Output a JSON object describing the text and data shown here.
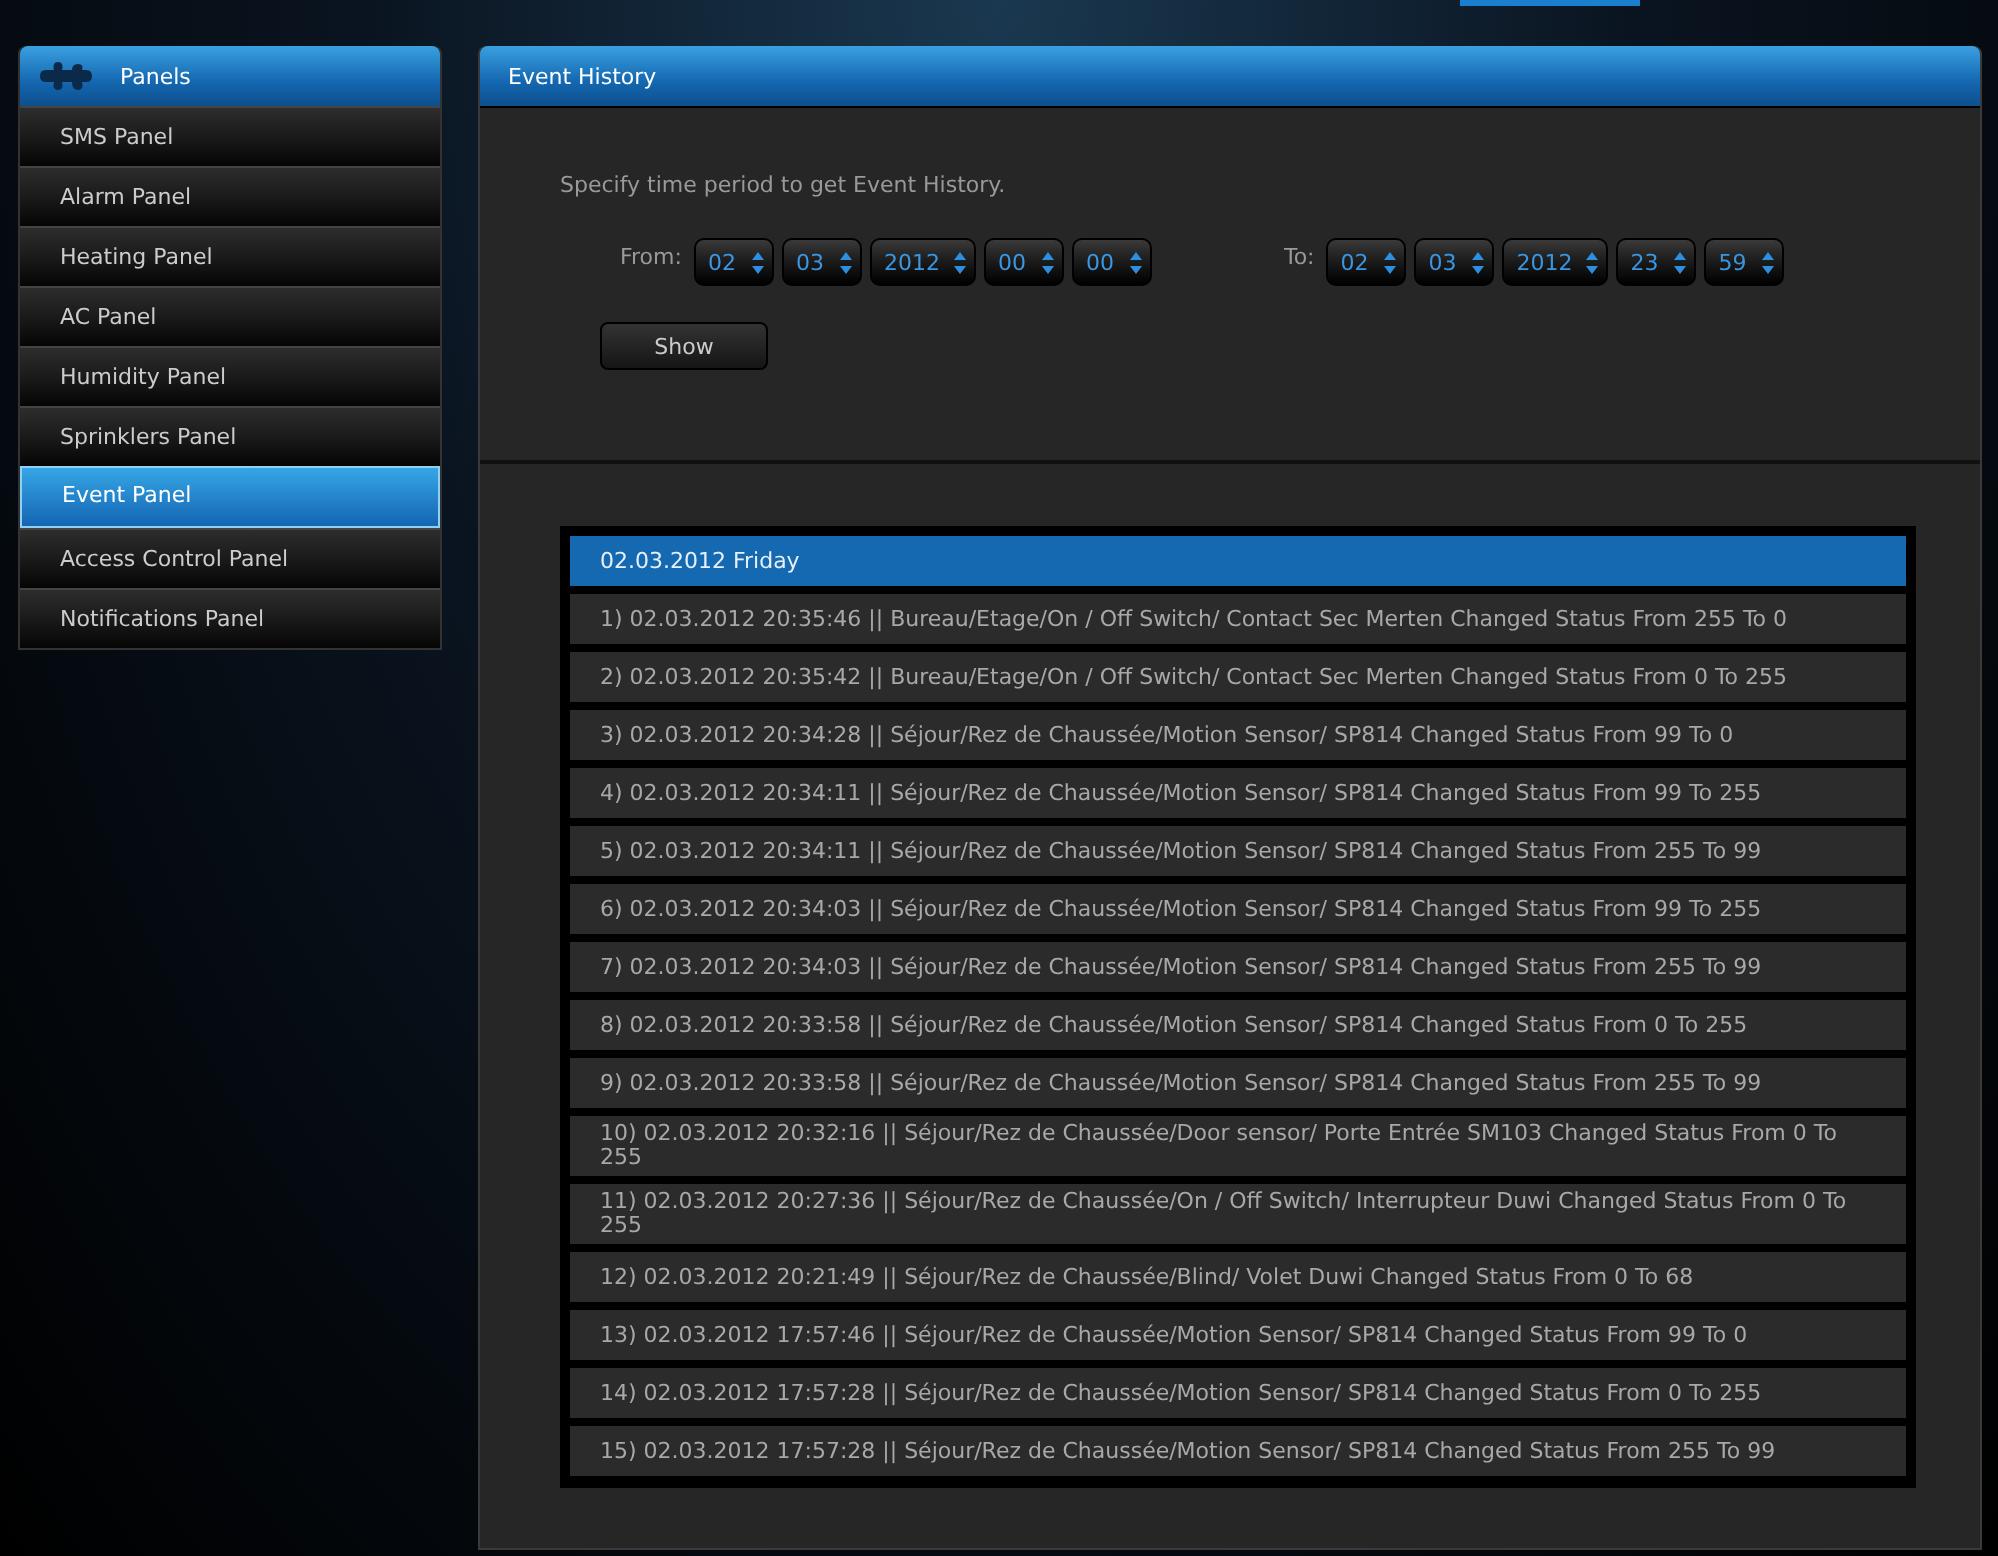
{
  "sidebar": {
    "title": "Panels",
    "items": [
      {
        "label": "SMS Panel",
        "selected": false
      },
      {
        "label": "Alarm Panel",
        "selected": false
      },
      {
        "label": "Heating Panel",
        "selected": false
      },
      {
        "label": "AC Panel",
        "selected": false
      },
      {
        "label": "Humidity Panel",
        "selected": false
      },
      {
        "label": "Sprinklers Panel",
        "selected": false
      },
      {
        "label": "Event Panel",
        "selected": true
      },
      {
        "label": "Access Control Panel",
        "selected": false
      },
      {
        "label": "Notifications Panel",
        "selected": false
      }
    ]
  },
  "main": {
    "title": "Event History",
    "instruction": "Specify time period to get Event History.",
    "from": {
      "label": "From:",
      "fields": [
        "02",
        "03",
        "2012",
        "00",
        "00"
      ]
    },
    "to": {
      "label": "To:",
      "fields": [
        "02",
        "03",
        "2012",
        "23",
        "59"
      ]
    },
    "show_button": "Show",
    "events": [
      {
        "kind": "header",
        "text": "02.03.2012 Friday"
      },
      {
        "kind": "event",
        "text": "1) 02.03.2012 20:35:46 || Bureau/Etage/On / Off Switch/ Contact Sec Merten Changed Status From 255 To 0"
      },
      {
        "kind": "event",
        "text": "2) 02.03.2012 20:35:42 || Bureau/Etage/On / Off Switch/ Contact Sec Merten Changed Status From 0 To 255"
      },
      {
        "kind": "event",
        "text": "3) 02.03.2012 20:34:28 || Séjour/Rez de Chaussée/Motion Sensor/ SP814 Changed Status From 99 To 0"
      },
      {
        "kind": "event",
        "text": "4) 02.03.2012 20:34:11 || Séjour/Rez de Chaussée/Motion Sensor/ SP814 Changed Status From 99 To 255"
      },
      {
        "kind": "event",
        "text": "5) 02.03.2012 20:34:11 || Séjour/Rez de Chaussée/Motion Sensor/ SP814 Changed Status From 255 To 99"
      },
      {
        "kind": "event",
        "text": "6) 02.03.2012 20:34:03 || Séjour/Rez de Chaussée/Motion Sensor/ SP814 Changed Status From 99 To 255"
      },
      {
        "kind": "event",
        "text": "7) 02.03.2012 20:34:03 || Séjour/Rez de Chaussée/Motion Sensor/ SP814 Changed Status From 255 To 99"
      },
      {
        "kind": "event",
        "text": "8) 02.03.2012 20:33:58 || Séjour/Rez de Chaussée/Motion Sensor/ SP814 Changed Status From 0 To 255"
      },
      {
        "kind": "event",
        "text": "9) 02.03.2012 20:33:58 || Séjour/Rez de Chaussée/Motion Sensor/ SP814 Changed Status From 255 To 99"
      },
      {
        "kind": "event",
        "text": "10) 02.03.2012 20:32:16 || Séjour/Rez de Chaussée/Door sensor/ Porte Entrée SM103 Changed Status From 0 To 255"
      },
      {
        "kind": "event",
        "text": "11) 02.03.2012 20:27:36 || Séjour/Rez de Chaussée/On / Off Switch/ Interrupteur Duwi Changed Status From 0 To 255"
      },
      {
        "kind": "event",
        "text": "12) 02.03.2012 20:21:49 || Séjour/Rez de Chaussée/Blind/ Volet Duwi Changed Status From 0 To 68"
      },
      {
        "kind": "event",
        "text": "13) 02.03.2012 17:57:46 || Séjour/Rez de Chaussée/Motion Sensor/ SP814 Changed Status From 99 To 0"
      },
      {
        "kind": "event",
        "text": "14) 02.03.2012 17:57:28 || Séjour/Rez de Chaussée/Motion Sensor/ SP814 Changed Status From 0 To 255"
      },
      {
        "kind": "event",
        "text": "15) 02.03.2012 17:57:28 || Séjour/Rez de Chaussée/Motion Sensor/ SP814 Changed Status From 255 To 99"
      }
    ]
  }
}
